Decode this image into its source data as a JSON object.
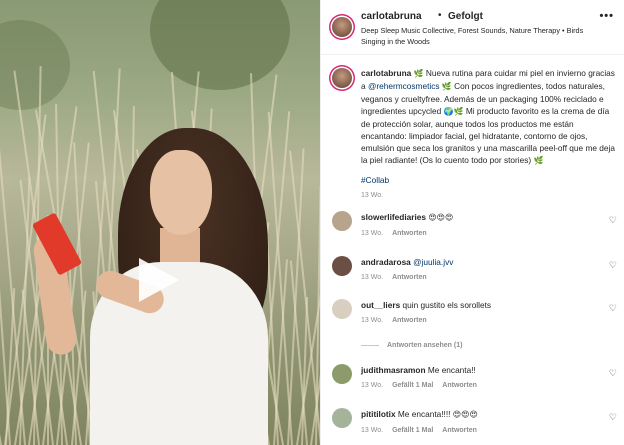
{
  "header": {
    "username": "carlotabruna",
    "separator": "•",
    "follow_status": "Gefolgt",
    "music": "Deep Sleep Music Collective, Forest Sounds, Nature Therapy • Birds Singing in the Woods",
    "more": "•••"
  },
  "caption": {
    "username": "carlotabruna",
    "emoji1": "🌿",
    "text_a": "Nueva rutina para cuidar mi piel en invierno gracias a",
    "mention": "@rehermcosmetics",
    "emoji2": "🌿",
    "text_b": "Con pocos ingredientes, todos naturales, veganos y crueltyfree. Además de un packaging 100% reciclado e ingredientes upcycled",
    "emoji3": "🌍🌿",
    "text_c": "Mi producto favorito es la crema de día de protección solar, aunque todos los productos me están encantando: limpiador facial, gel hidratante, contorno de ojos, emulsión que seca los granitos y una mascarilla peel-off que me deja la piel radiante! (Os lo cuento todo por stories)",
    "emoji4": "🌿",
    "hashtag": "#Collab",
    "age": "13 Wo."
  },
  "comments": [
    {
      "username": "slowerlifediaries",
      "text": "",
      "emoji": "😍😍😍",
      "age": "13 Wo.",
      "likes": "",
      "reply": "Antworten",
      "avatar_color": "#b8a38d"
    },
    {
      "username": "andradarosa",
      "text": "",
      "mention": "@juulia.jvv",
      "age": "13 Wo.",
      "likes": "",
      "reply": "Antworten",
      "avatar_color": "#6b4f45"
    },
    {
      "username": "out__liers",
      "text": "quin gustito els sorollets",
      "age": "13 Wo.",
      "likes": "",
      "reply": "Antworten",
      "avatar_color": "#d9cfc0",
      "view_replies": "Antworten ansehen (1)"
    },
    {
      "username": "judithmasramon",
      "text": "Me encanta!!",
      "age": "13 Wo.",
      "likes": "Gefällt 1 Mal",
      "reply": "Antworten",
      "avatar_color": "#8b9b6a"
    },
    {
      "username": "pititilotix",
      "text": "Me encanta!!!!",
      "emoji": "😍😍😍",
      "age": "13 Wo.",
      "likes": "Gefällt 1 Mal",
      "reply": "Antworten",
      "avatar_color": "#a4b39a"
    }
  ],
  "icons": {
    "heart": "heart-icon",
    "play": "play-icon",
    "more": "more-icon"
  }
}
